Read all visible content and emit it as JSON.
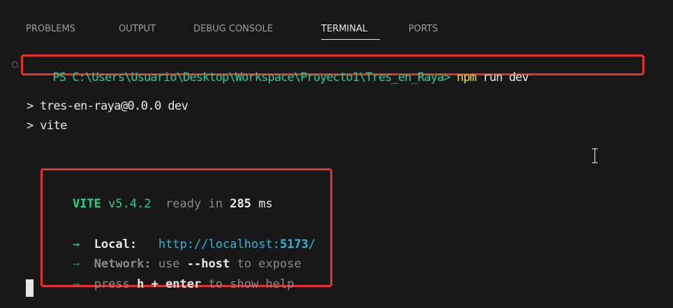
{
  "tabs": [
    {
      "label": "PROBLEMS",
      "active": false
    },
    {
      "label": "OUTPUT",
      "active": false
    },
    {
      "label": "DEBUG CONSOLE",
      "active": false
    },
    {
      "label": "TERMINAL",
      "active": true
    },
    {
      "label": "PORTS",
      "active": false
    }
  ],
  "terminal": {
    "prompt": "PS C:\\Users\\Usuario\\Desktop\\Workspace\\Proyecto1\\Tres_en_Raya>",
    "command_bin": "npm",
    "command_args": "run dev",
    "output_line1": "> tres-en-raya@0.0.0 dev",
    "output_line2": "> vite",
    "vite_name": "VITE",
    "vite_version": "v5.4.2",
    "ready_text": "ready in",
    "ready_ms": "285",
    "ms_unit": "ms",
    "arrow": "→",
    "local_label": "Local:",
    "local_url_prefix": "http://localhost:",
    "local_url_port": "5173",
    "local_url_suffix": "/",
    "network_label": "Network:",
    "network_use": "use",
    "network_flag": "--host",
    "network_rest": "to expose",
    "press_text": "press",
    "press_key": "h + enter",
    "press_rest": "to show help"
  },
  "colors": {
    "background": "#181818",
    "highlight_border": "#e5312c",
    "prompt_green": "#23d18b",
    "npm_yellow": "#e5e510",
    "url_cyan": "#29b8db"
  },
  "icons": {
    "decoration": "circle-outline-icon",
    "pointer": "text-ibeam-cursor-icon"
  }
}
